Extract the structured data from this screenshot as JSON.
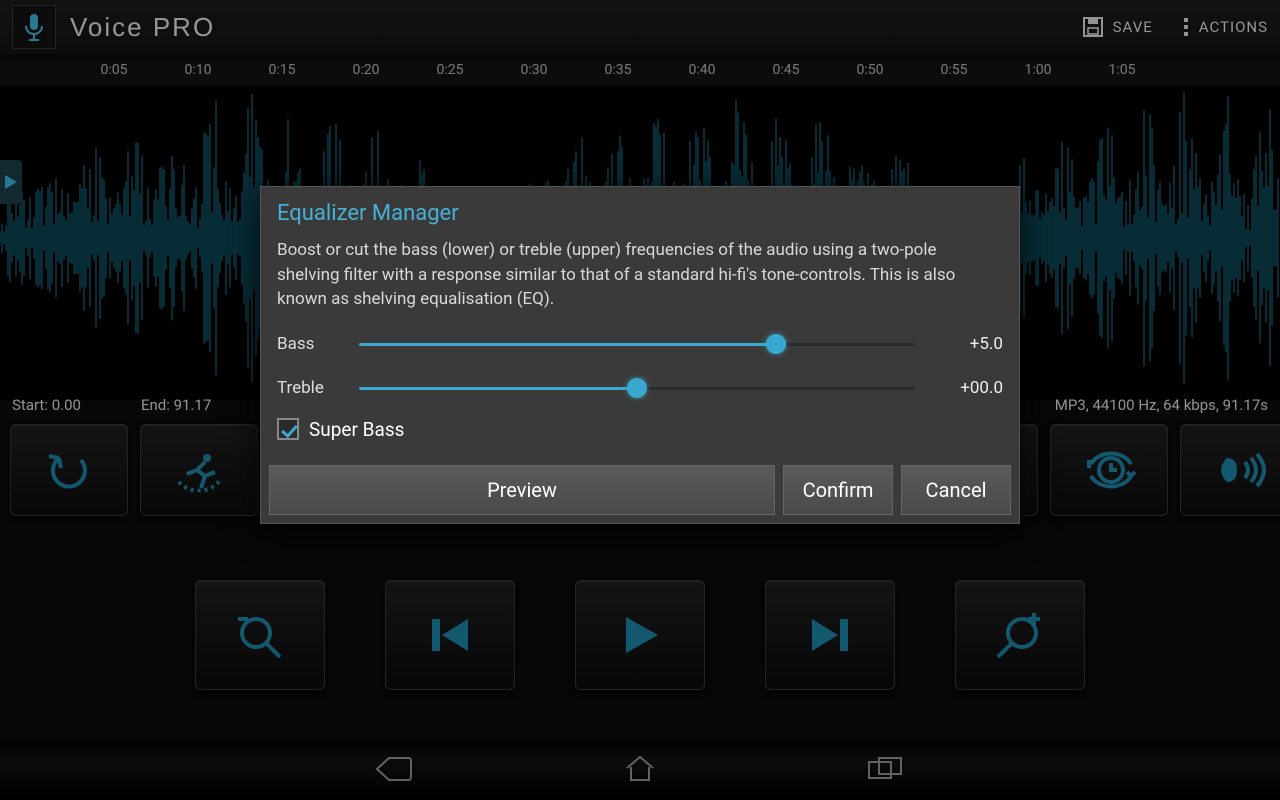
{
  "app": {
    "title": "Voice PRO"
  },
  "header": {
    "save": "SAVE",
    "actions": "ACTIONS"
  },
  "timeline": {
    "ticks": [
      "0:05",
      "0:10",
      "0:15",
      "0:20",
      "0:25",
      "0:30",
      "0:35",
      "0:40",
      "0:45",
      "0:50",
      "0:55",
      "1:00",
      "1:05"
    ]
  },
  "info": {
    "start_label": "Start:",
    "start_val": "0.00",
    "end_label": "End:",
    "end_val": "91.17",
    "meta": "MP3, 44100 Hz, 64 kbps, 91.17s"
  },
  "dialog": {
    "title": "Equalizer Manager",
    "description": "Boost or cut the bass (lower) or treble (upper) frequencies of the audio using a two-pole shelving filter with a response similar to that of a standard hi-fi's tone-controls. This is also known as shelving equalisation (EQ).",
    "bass_label": "Bass",
    "bass_value": "+5.0",
    "bass_pct": 75,
    "treble_label": "Treble",
    "treble_value": "+00.0",
    "treble_pct": 50,
    "superbass_label": "Super Bass",
    "superbass_checked": true,
    "preview": "Preview",
    "confirm": "Confirm",
    "cancel": "Cancel"
  }
}
